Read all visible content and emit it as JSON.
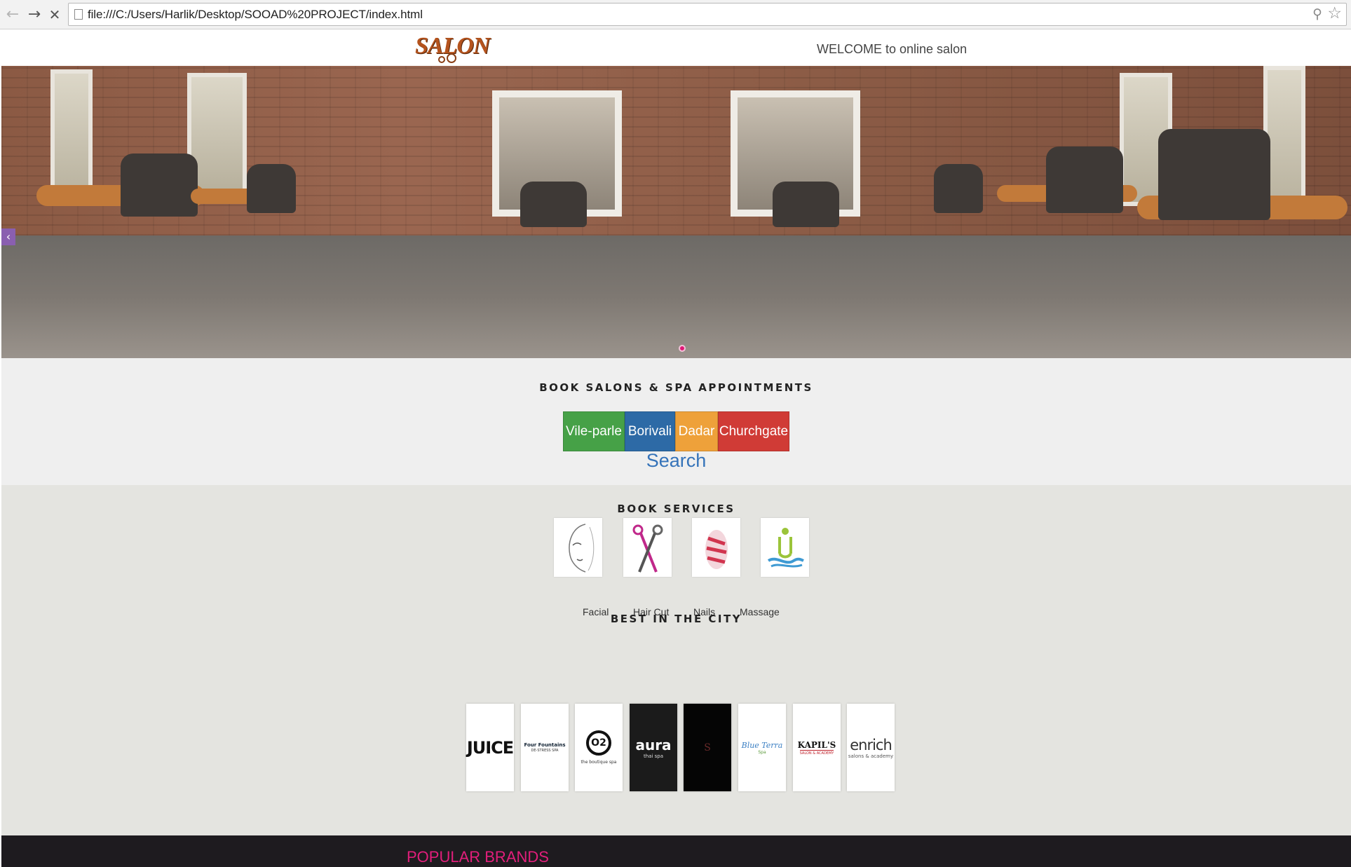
{
  "browser": {
    "url": "file:///C:/Users/Harlik/Desktop/SOOAD%20PROJECT/index.html"
  },
  "header": {
    "logo_text": "SALON",
    "welcome": "WELCOME to online salon"
  },
  "book_section": {
    "title": "BOOK SALONS & SPA APPOINTMENTS",
    "locations": [
      "Vile-parle",
      "Borivali",
      "Dadar",
      "Churchgate"
    ],
    "location_colors": [
      "#46a147",
      "#2d6aa6",
      "#eea13a",
      "#d03b36"
    ],
    "search_label": "Search"
  },
  "services": {
    "title": "BOOK SERVICES",
    "items": [
      {
        "label": "Facial",
        "icon": "face-icon"
      },
      {
        "label": "Hair Cut",
        "icon": "scissors-icon"
      },
      {
        "label": "Nails",
        "icon": "nail-polish-icon"
      },
      {
        "label": "Massage",
        "icon": "massage-icon"
      }
    ]
  },
  "best_in_city": {
    "title": "BEST IN THE CITY",
    "brands": [
      {
        "name": "JUICE",
        "sub": ""
      },
      {
        "name": "Four Fountains",
        "sub": "DE-STRESS SPA"
      },
      {
        "name": "O2",
        "sub": "the boutique spa"
      },
      {
        "name": "aura",
        "sub": "thai spa"
      },
      {
        "name": "S",
        "sub": ""
      },
      {
        "name": "Blue Terra",
        "sub": "Spa"
      },
      {
        "name": "KAPIL'S",
        "sub": "SALON & ACADEMY"
      },
      {
        "name": "enrich",
        "sub": "salons & academy"
      }
    ]
  },
  "footer": {
    "title": "POPULAR BRANDS"
  }
}
